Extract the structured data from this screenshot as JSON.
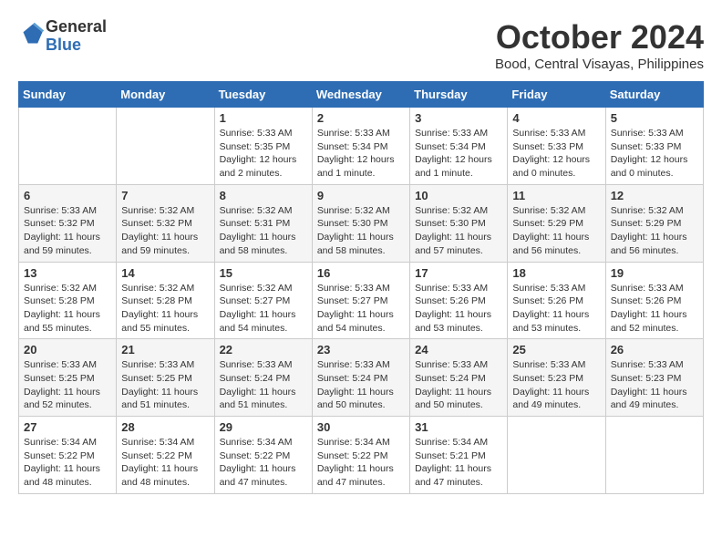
{
  "header": {
    "logo_line1": "General",
    "logo_line2": "Blue",
    "month_year": "October 2024",
    "location": "Bood, Central Visayas, Philippines"
  },
  "days_of_week": [
    "Sunday",
    "Monday",
    "Tuesday",
    "Wednesday",
    "Thursday",
    "Friday",
    "Saturday"
  ],
  "weeks": [
    [
      {
        "day": "",
        "content": ""
      },
      {
        "day": "",
        "content": ""
      },
      {
        "day": "1",
        "content": "Sunrise: 5:33 AM\nSunset: 5:35 PM\nDaylight: 12 hours\nand 2 minutes."
      },
      {
        "day": "2",
        "content": "Sunrise: 5:33 AM\nSunset: 5:34 PM\nDaylight: 12 hours\nand 1 minute."
      },
      {
        "day": "3",
        "content": "Sunrise: 5:33 AM\nSunset: 5:34 PM\nDaylight: 12 hours\nand 1 minute."
      },
      {
        "day": "4",
        "content": "Sunrise: 5:33 AM\nSunset: 5:33 PM\nDaylight: 12 hours\nand 0 minutes."
      },
      {
        "day": "5",
        "content": "Sunrise: 5:33 AM\nSunset: 5:33 PM\nDaylight: 12 hours\nand 0 minutes."
      }
    ],
    [
      {
        "day": "6",
        "content": "Sunrise: 5:33 AM\nSunset: 5:32 PM\nDaylight: 11 hours\nand 59 minutes."
      },
      {
        "day": "7",
        "content": "Sunrise: 5:32 AM\nSunset: 5:32 PM\nDaylight: 11 hours\nand 59 minutes."
      },
      {
        "day": "8",
        "content": "Sunrise: 5:32 AM\nSunset: 5:31 PM\nDaylight: 11 hours\nand 58 minutes."
      },
      {
        "day": "9",
        "content": "Sunrise: 5:32 AM\nSunset: 5:30 PM\nDaylight: 11 hours\nand 58 minutes."
      },
      {
        "day": "10",
        "content": "Sunrise: 5:32 AM\nSunset: 5:30 PM\nDaylight: 11 hours\nand 57 minutes."
      },
      {
        "day": "11",
        "content": "Sunrise: 5:32 AM\nSunset: 5:29 PM\nDaylight: 11 hours\nand 56 minutes."
      },
      {
        "day": "12",
        "content": "Sunrise: 5:32 AM\nSunset: 5:29 PM\nDaylight: 11 hours\nand 56 minutes."
      }
    ],
    [
      {
        "day": "13",
        "content": "Sunrise: 5:32 AM\nSunset: 5:28 PM\nDaylight: 11 hours\nand 55 minutes."
      },
      {
        "day": "14",
        "content": "Sunrise: 5:32 AM\nSunset: 5:28 PM\nDaylight: 11 hours\nand 55 minutes."
      },
      {
        "day": "15",
        "content": "Sunrise: 5:32 AM\nSunset: 5:27 PM\nDaylight: 11 hours\nand 54 minutes."
      },
      {
        "day": "16",
        "content": "Sunrise: 5:33 AM\nSunset: 5:27 PM\nDaylight: 11 hours\nand 54 minutes."
      },
      {
        "day": "17",
        "content": "Sunrise: 5:33 AM\nSunset: 5:26 PM\nDaylight: 11 hours\nand 53 minutes."
      },
      {
        "day": "18",
        "content": "Sunrise: 5:33 AM\nSunset: 5:26 PM\nDaylight: 11 hours\nand 53 minutes."
      },
      {
        "day": "19",
        "content": "Sunrise: 5:33 AM\nSunset: 5:26 PM\nDaylight: 11 hours\nand 52 minutes."
      }
    ],
    [
      {
        "day": "20",
        "content": "Sunrise: 5:33 AM\nSunset: 5:25 PM\nDaylight: 11 hours\nand 52 minutes."
      },
      {
        "day": "21",
        "content": "Sunrise: 5:33 AM\nSunset: 5:25 PM\nDaylight: 11 hours\nand 51 minutes."
      },
      {
        "day": "22",
        "content": "Sunrise: 5:33 AM\nSunset: 5:24 PM\nDaylight: 11 hours\nand 51 minutes."
      },
      {
        "day": "23",
        "content": "Sunrise: 5:33 AM\nSunset: 5:24 PM\nDaylight: 11 hours\nand 50 minutes."
      },
      {
        "day": "24",
        "content": "Sunrise: 5:33 AM\nSunset: 5:24 PM\nDaylight: 11 hours\nand 50 minutes."
      },
      {
        "day": "25",
        "content": "Sunrise: 5:33 AM\nSunset: 5:23 PM\nDaylight: 11 hours\nand 49 minutes."
      },
      {
        "day": "26",
        "content": "Sunrise: 5:33 AM\nSunset: 5:23 PM\nDaylight: 11 hours\nand 49 minutes."
      }
    ],
    [
      {
        "day": "27",
        "content": "Sunrise: 5:34 AM\nSunset: 5:22 PM\nDaylight: 11 hours\nand 48 minutes."
      },
      {
        "day": "28",
        "content": "Sunrise: 5:34 AM\nSunset: 5:22 PM\nDaylight: 11 hours\nand 48 minutes."
      },
      {
        "day": "29",
        "content": "Sunrise: 5:34 AM\nSunset: 5:22 PM\nDaylight: 11 hours\nand 47 minutes."
      },
      {
        "day": "30",
        "content": "Sunrise: 5:34 AM\nSunset: 5:22 PM\nDaylight: 11 hours\nand 47 minutes."
      },
      {
        "day": "31",
        "content": "Sunrise: 5:34 AM\nSunset: 5:21 PM\nDaylight: 11 hours\nand 47 minutes."
      },
      {
        "day": "",
        "content": ""
      },
      {
        "day": "",
        "content": ""
      }
    ]
  ]
}
